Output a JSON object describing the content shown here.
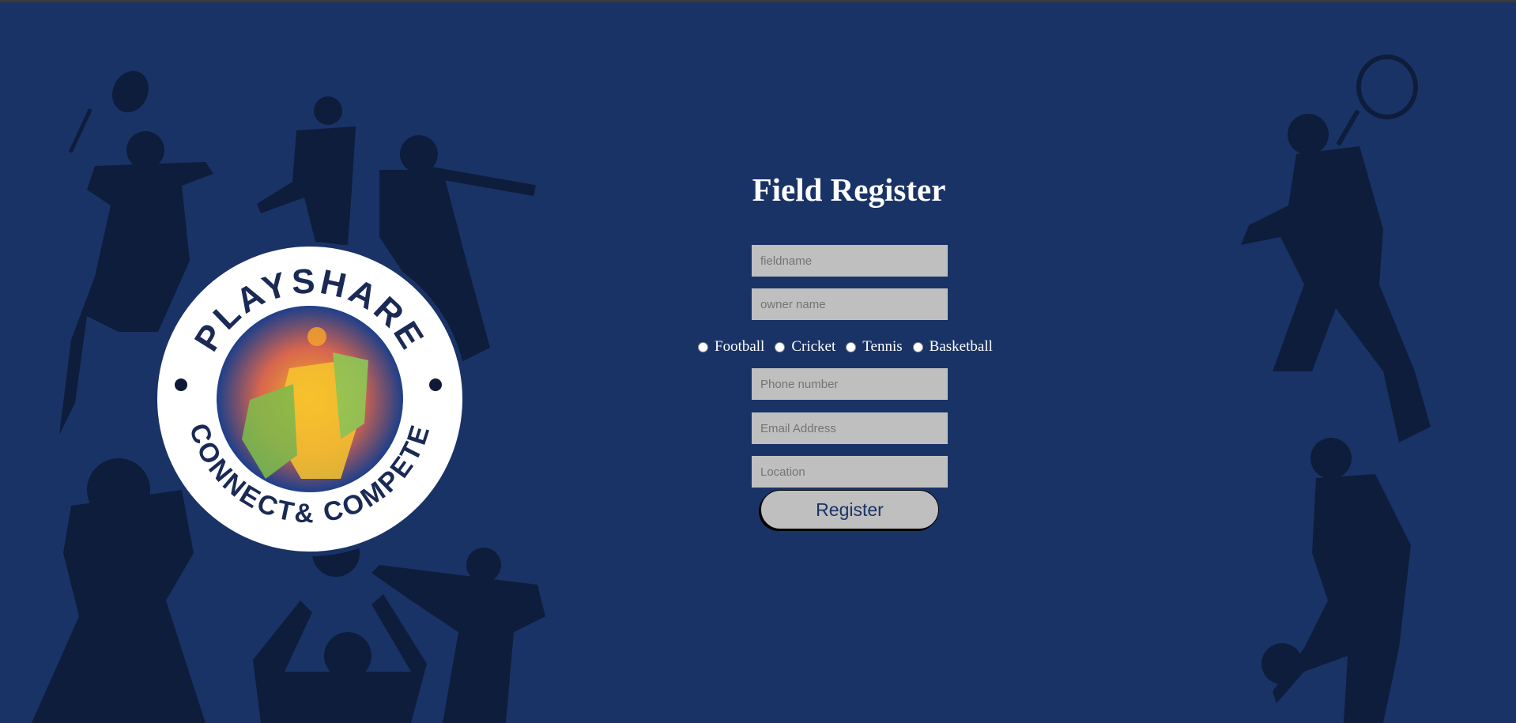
{
  "page": {
    "title": "Field Register"
  },
  "brand": {
    "top_text": "PLAYSHARE",
    "bottom_text": "CONNECT& COMPETE"
  },
  "form": {
    "fieldname_placeholder": "fieldname",
    "owner_placeholder": "owner name",
    "sports": [
      {
        "label": "Football"
      },
      {
        "label": "Cricket"
      },
      {
        "label": "Tennis"
      },
      {
        "label": "Basketball"
      }
    ],
    "phone_placeholder": "Phone number",
    "email_placeholder": "Email Address",
    "location_placeholder": "Location",
    "submit_label": "Register"
  },
  "colors": {
    "background": "#1a3366",
    "silhouette": "#0e1d3c",
    "input_bg": "#bfbfbf",
    "title": "#ffffff"
  }
}
